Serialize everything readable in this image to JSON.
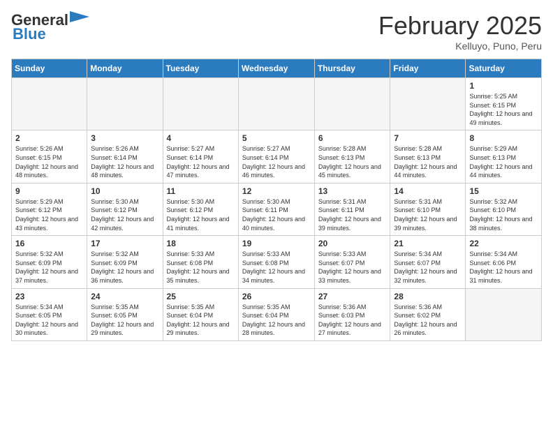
{
  "header": {
    "logo_general": "General",
    "logo_blue": "Blue",
    "month_year": "February 2025",
    "location": "Kelluyo, Puno, Peru"
  },
  "weekdays": [
    "Sunday",
    "Monday",
    "Tuesday",
    "Wednesday",
    "Thursday",
    "Friday",
    "Saturday"
  ],
  "weeks": [
    [
      {
        "day": "",
        "empty": true
      },
      {
        "day": "",
        "empty": true
      },
      {
        "day": "",
        "empty": true
      },
      {
        "day": "",
        "empty": true
      },
      {
        "day": "",
        "empty": true
      },
      {
        "day": "",
        "empty": true
      },
      {
        "day": "1",
        "sunrise": "5:25 AM",
        "sunset": "6:15 PM",
        "daylight": "12 hours and 49 minutes."
      }
    ],
    [
      {
        "day": "2",
        "sunrise": "5:26 AM",
        "sunset": "6:15 PM",
        "daylight": "12 hours and 48 minutes."
      },
      {
        "day": "3",
        "sunrise": "5:26 AM",
        "sunset": "6:14 PM",
        "daylight": "12 hours and 48 minutes."
      },
      {
        "day": "4",
        "sunrise": "5:27 AM",
        "sunset": "6:14 PM",
        "daylight": "12 hours and 47 minutes."
      },
      {
        "day": "5",
        "sunrise": "5:27 AM",
        "sunset": "6:14 PM",
        "daylight": "12 hours and 46 minutes."
      },
      {
        "day": "6",
        "sunrise": "5:28 AM",
        "sunset": "6:13 PM",
        "daylight": "12 hours and 45 minutes."
      },
      {
        "day": "7",
        "sunrise": "5:28 AM",
        "sunset": "6:13 PM",
        "daylight": "12 hours and 44 minutes."
      },
      {
        "day": "8",
        "sunrise": "5:29 AM",
        "sunset": "6:13 PM",
        "daylight": "12 hours and 44 minutes."
      }
    ],
    [
      {
        "day": "9",
        "sunrise": "5:29 AM",
        "sunset": "6:12 PM",
        "daylight": "12 hours and 43 minutes."
      },
      {
        "day": "10",
        "sunrise": "5:30 AM",
        "sunset": "6:12 PM",
        "daylight": "12 hours and 42 minutes."
      },
      {
        "day": "11",
        "sunrise": "5:30 AM",
        "sunset": "6:12 PM",
        "daylight": "12 hours and 41 minutes."
      },
      {
        "day": "12",
        "sunrise": "5:30 AM",
        "sunset": "6:11 PM",
        "daylight": "12 hours and 40 minutes."
      },
      {
        "day": "13",
        "sunrise": "5:31 AM",
        "sunset": "6:11 PM",
        "daylight": "12 hours and 39 minutes."
      },
      {
        "day": "14",
        "sunrise": "5:31 AM",
        "sunset": "6:10 PM",
        "daylight": "12 hours and 39 minutes."
      },
      {
        "day": "15",
        "sunrise": "5:32 AM",
        "sunset": "6:10 PM",
        "daylight": "12 hours and 38 minutes."
      }
    ],
    [
      {
        "day": "16",
        "sunrise": "5:32 AM",
        "sunset": "6:09 PM",
        "daylight": "12 hours and 37 minutes."
      },
      {
        "day": "17",
        "sunrise": "5:32 AM",
        "sunset": "6:09 PM",
        "daylight": "12 hours and 36 minutes."
      },
      {
        "day": "18",
        "sunrise": "5:33 AM",
        "sunset": "6:08 PM",
        "daylight": "12 hours and 35 minutes."
      },
      {
        "day": "19",
        "sunrise": "5:33 AM",
        "sunset": "6:08 PM",
        "daylight": "12 hours and 34 minutes."
      },
      {
        "day": "20",
        "sunrise": "5:33 AM",
        "sunset": "6:07 PM",
        "daylight": "12 hours and 33 minutes."
      },
      {
        "day": "21",
        "sunrise": "5:34 AM",
        "sunset": "6:07 PM",
        "daylight": "12 hours and 32 minutes."
      },
      {
        "day": "22",
        "sunrise": "5:34 AM",
        "sunset": "6:06 PM",
        "daylight": "12 hours and 31 minutes."
      }
    ],
    [
      {
        "day": "23",
        "sunrise": "5:34 AM",
        "sunset": "6:05 PM",
        "daylight": "12 hours and 30 minutes."
      },
      {
        "day": "24",
        "sunrise": "5:35 AM",
        "sunset": "6:05 PM",
        "daylight": "12 hours and 29 minutes."
      },
      {
        "day": "25",
        "sunrise": "5:35 AM",
        "sunset": "6:04 PM",
        "daylight": "12 hours and 29 minutes."
      },
      {
        "day": "26",
        "sunrise": "5:35 AM",
        "sunset": "6:04 PM",
        "daylight": "12 hours and 28 minutes."
      },
      {
        "day": "27",
        "sunrise": "5:36 AM",
        "sunset": "6:03 PM",
        "daylight": "12 hours and 27 minutes."
      },
      {
        "day": "28",
        "sunrise": "5:36 AM",
        "sunset": "6:02 PM",
        "daylight": "12 hours and 26 minutes."
      },
      {
        "day": "",
        "empty": true
      }
    ]
  ]
}
